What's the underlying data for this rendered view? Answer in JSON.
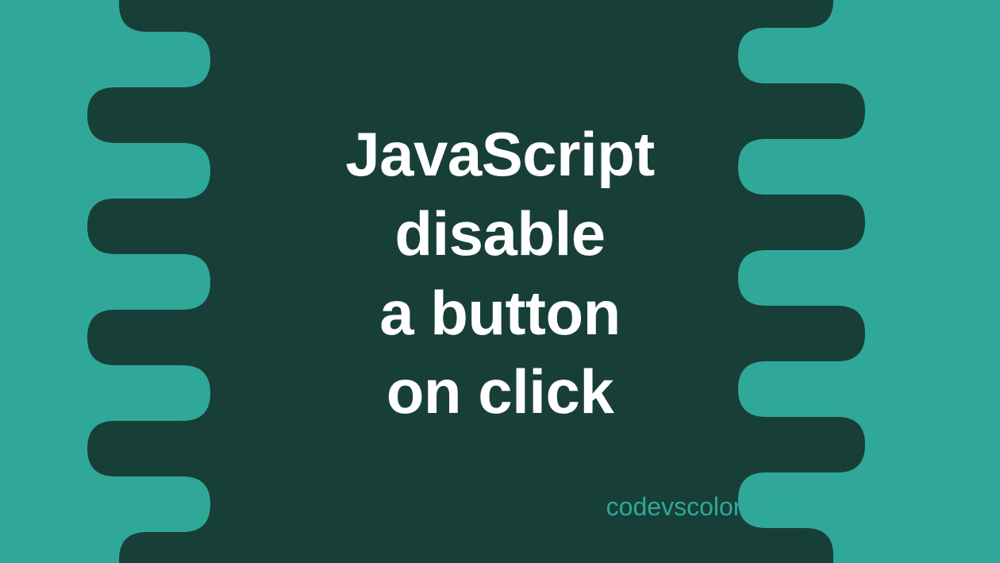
{
  "colors": {
    "bg_outer": "#2fa89a",
    "bg_blob": "#173f38",
    "text": "#ffffff",
    "watermark": "#2fa89a"
  },
  "title": {
    "line1": "JavaScript",
    "line2": "disable",
    "line3": "a button",
    "line4": "on click"
  },
  "watermark": "codevscolor.com"
}
